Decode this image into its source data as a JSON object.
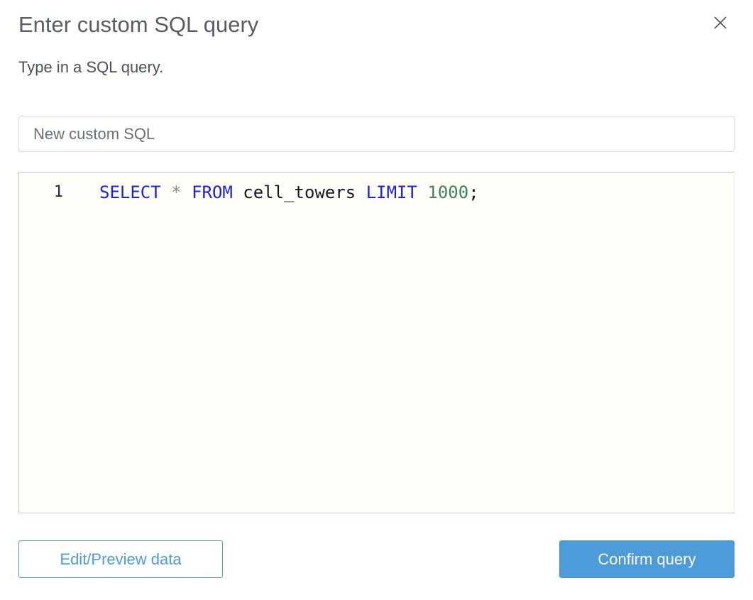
{
  "dialog": {
    "title": "Enter custom SQL query",
    "subtitle": "Type in a SQL query."
  },
  "name_input": {
    "value": "New custom SQL"
  },
  "editor": {
    "lines": [
      {
        "number": "1",
        "tokens": [
          {
            "type": "keyword",
            "text": "SELECT"
          },
          {
            "type": "plain",
            "text": " "
          },
          {
            "type": "operator",
            "text": "*"
          },
          {
            "type": "plain",
            "text": " "
          },
          {
            "type": "keyword",
            "text": "FROM"
          },
          {
            "type": "plain",
            "text": " cell_towers "
          },
          {
            "type": "keyword",
            "text": "LIMIT"
          },
          {
            "type": "plain",
            "text": " "
          },
          {
            "type": "number",
            "text": "1000"
          },
          {
            "type": "plain",
            "text": ";"
          }
        ]
      }
    ],
    "full_query": "SELECT * FROM cell_towers LIMIT 1000;"
  },
  "footer": {
    "edit_preview_label": "Edit/Preview data",
    "confirm_label": "Confirm query"
  },
  "colors": {
    "accent_blue": "#4D9CD9",
    "keyword_blue": "#1D22E0",
    "number_green": "#3A8257",
    "operator_gray": "#8C8C8C",
    "code_text": "#121921",
    "line_number": "#28283E",
    "editor_bg": "#FFFEF8",
    "editor_border": "#C6C6C6",
    "title_gray": "#565D64",
    "input_text": "#687078",
    "input_border": "#D9D9D9"
  }
}
